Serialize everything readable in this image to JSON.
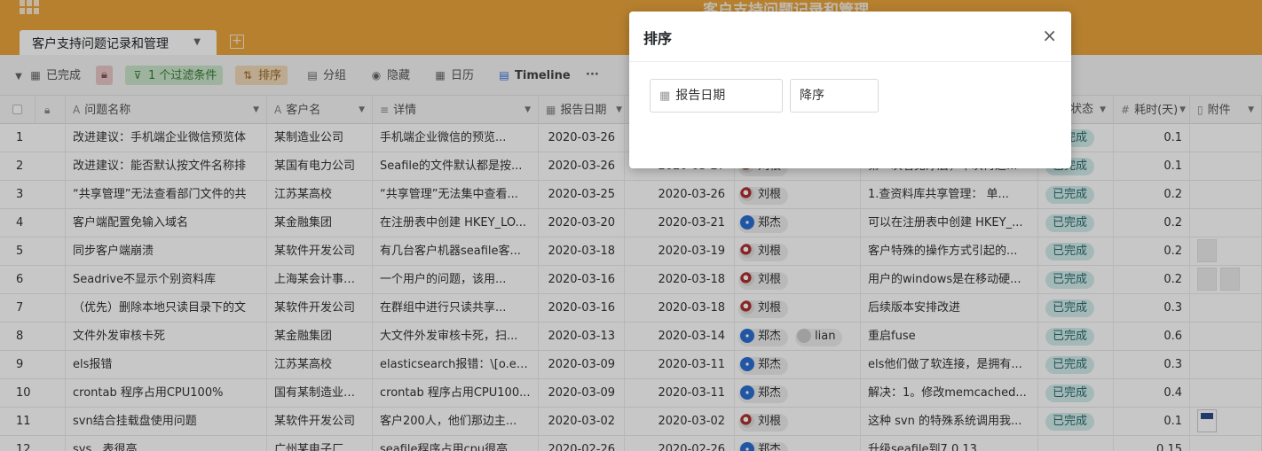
{
  "header": {
    "base_title": "客户支持问题记录和管理",
    "active_tab": "客户支持问题记录和管理",
    "add_tab": "+"
  },
  "toolbar": {
    "view": "已完成",
    "filter": "1 个过滤条件",
    "sort": "排序",
    "group": "分组",
    "hide": "隐藏",
    "calendar": "日历",
    "timeline": "Timeline",
    "more": "···"
  },
  "columns": [
    "问题名称",
    "客户名",
    "详情",
    "报告日期",
    "状态",
    "耗时(天)",
    "附件"
  ],
  "rows": [
    {
      "no": "1",
      "name": "改进建议：手机端企业微信预览体",
      "customer": "某制造业公司",
      "detail": "手机端企业微信的预览...",
      "report": "2020-03-26",
      "done": "",
      "users": [],
      "note": "",
      "status": "已完成",
      "days": "0.1",
      "files": 0
    },
    {
      "no": "2",
      "name": "改进建议：能否默认按文件名称排",
      "customer": "某国有电力公司",
      "detail": "Seafile的文件默认都是按...",
      "report": "2020-03-26",
      "done": "2020-03-27",
      "users": [
        {
          "name": "刘根",
          "kind": "liu"
        }
      ],
      "note": "第一次看见浮层，下次再进...",
      "status": "已完成",
      "days": "0.1",
      "files": 0
    },
    {
      "no": "3",
      "name": "“共享管理”无法查看部门文件的共",
      "customer": "江苏某高校",
      "detail": "“共享管理”无法集中查看...",
      "report": "2020-03-25",
      "done": "2020-03-26",
      "users": [
        {
          "name": "刘根",
          "kind": "liu"
        }
      ],
      "note": "1.查资料库共享管理： 单...",
      "status": "已完成",
      "days": "0.2",
      "files": 0
    },
    {
      "no": "4",
      "name": "客户端配置免输入域名",
      "customer": "某金融集团",
      "detail": "在注册表中创建 HKEY_LO...",
      "report": "2020-03-20",
      "done": "2020-03-21",
      "users": [
        {
          "name": "郑杰",
          "kind": "zheng"
        }
      ],
      "note": "可以在注册表中创建 HKEY_...",
      "status": "已完成",
      "days": "0.2",
      "files": 0
    },
    {
      "no": "5",
      "name": "同步客户端崩溃",
      "customer": "某软件开发公司",
      "detail": "有几台客户机器seafile客...",
      "report": "2020-03-18",
      "done": "2020-03-19",
      "users": [
        {
          "name": "刘根",
          "kind": "liu"
        }
      ],
      "note": "客户特殊的操作方式引起的...",
      "status": "已完成",
      "days": "0.2",
      "files": 1
    },
    {
      "no": "6",
      "name": "Seadrive不显示个别资料库",
      "customer": "上海某会计事务所",
      "detail": "一个用户的问题，该用...",
      "report": "2020-03-16",
      "done": "2020-03-18",
      "users": [
        {
          "name": "刘根",
          "kind": "liu"
        }
      ],
      "note": "用户的windows是在移动硬...",
      "status": "已完成",
      "days": "0.2",
      "files": 2
    },
    {
      "no": "7",
      "name": "（优先）删除本地只读目录下的文",
      "customer": "某软件开发公司",
      "detail": "在群组中进行只读共享...",
      "report": "2020-03-16",
      "done": "2020-03-18",
      "users": [
        {
          "name": "刘根",
          "kind": "liu"
        }
      ],
      "note": "后续版本安排改进",
      "status": "已完成",
      "days": "0.3",
      "files": 0
    },
    {
      "no": "8",
      "name": "文件外发审核卡死",
      "customer": "某金融集团",
      "detail": "大文件外发审核卡死，扫...",
      "report": "2020-03-13",
      "done": "2020-03-14",
      "users": [
        {
          "name": "郑杰",
          "kind": "zheng"
        },
        {
          "name": "lian",
          "kind": "lian"
        }
      ],
      "note": "重启fuse",
      "status": "已完成",
      "days": "0.6",
      "files": 0
    },
    {
      "no": "9",
      "name": "els报错",
      "customer": "江苏某高校",
      "detail": "elasticsearch报错：\\[o.e....",
      "report": "2020-03-09",
      "done": "2020-03-11",
      "users": [
        {
          "name": "郑杰",
          "kind": "zheng"
        }
      ],
      "note": "els他们做了软连接，是拥有...",
      "status": "已完成",
      "days": "0.3",
      "files": 0
    },
    {
      "no": "10",
      "name": "crontab 程序占用CPU100%",
      "customer": "国有某制造业公司",
      "detail": "crontab 程序占用CPU100...",
      "report": "2020-03-09",
      "done": "2020-03-11",
      "users": [
        {
          "name": "郑杰",
          "kind": "zheng"
        }
      ],
      "note": "解决：1。修改memcached...",
      "status": "已完成",
      "days": "0.4",
      "files": 0
    },
    {
      "no": "11",
      "name": "svn结合挂载盘使用问题",
      "customer": "某软件开发公司",
      "detail": "客户200人，他们那边主...",
      "report": "2020-03-02",
      "done": "2020-03-02",
      "users": [
        {
          "name": "刘根",
          "kind": "liu"
        }
      ],
      "note": "这种 svn 的特殊系统调用我...",
      "status": "已完成",
      "days": "0.1",
      "files": 3
    },
    {
      "no": "12",
      "name": "sys...表很高",
      "customer": "广州某电子厂",
      "detail": "seafile程序占用cpu很高...",
      "report": "2020-02-26",
      "done": "2020-02-26",
      "users": [
        {
          "name": "郑杰",
          "kind": "zheng"
        }
      ],
      "note": "升级seafile到7.0.13",
      "status": "",
      "days": "0.15",
      "files": 0
    }
  ],
  "dialog": {
    "title": "排序",
    "close": "×",
    "field": "报告日期",
    "order": "降序"
  }
}
